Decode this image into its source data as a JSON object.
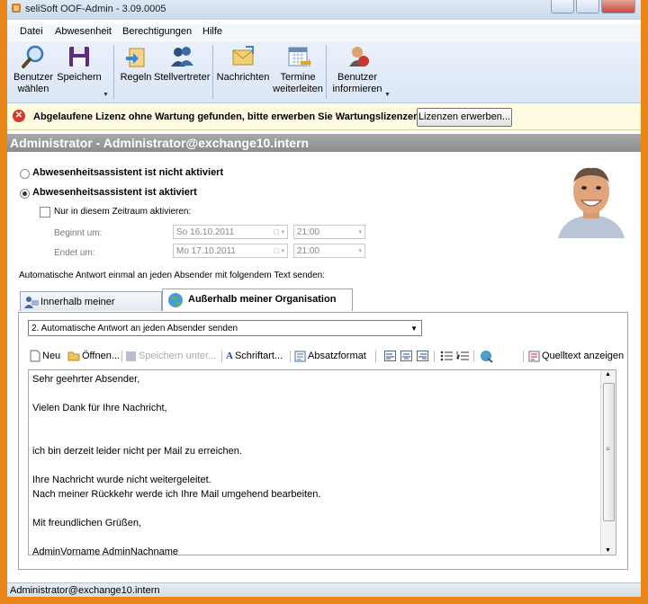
{
  "window": {
    "title": "seliSoft OOF-Admin - 3.09.0005"
  },
  "menu": [
    "Datei",
    "Abwesenheit",
    "Berechtigungen",
    "Hilfe"
  ],
  "toolbar": {
    "user_select": "Benutzer wählen",
    "user_select_l1": "Benutzer",
    "user_select_l2": "wählen",
    "save": "Speichern",
    "rules": "Regeln",
    "deputy": "Stellvertreter",
    "messages": "Nachrichten",
    "forward_l1": "Termine",
    "forward_l2": "weiterleiten",
    "inform_l1": "Benutzer",
    "inform_l2": "informieren"
  },
  "license": {
    "message": "Abgelaufene Lizenz ohne Wartung gefunden, bitte erwerben Sie Wartungslizenzen.",
    "button": "Lizenzen erwerben..."
  },
  "admin_header": "Administrator - Administrator@exchange10.intern",
  "assistant": {
    "option_inactive": "Abwesenheitsassistent ist nicht aktiviert",
    "option_active": "Abwesenheitsassistent ist aktiviert",
    "selected": "active",
    "period_checkbox": "Nur in diesem Zeitraum aktivieren:",
    "period_checked": false,
    "begin_label": "Beginnt um:",
    "end_label": "Endet um:",
    "begin_date": "So 16.10.2011",
    "begin_time": "21:00",
    "end_date": "Mo 17.10.2011",
    "end_time": "21:00",
    "auto_reply_hint": "Automatische Antwort einmal an jeden Absender mit folgendem Text senden:"
  },
  "tabs": {
    "internal": "Innerhalb meiner Organisation",
    "external": "Außerhalb meiner Organisation (An)"
  },
  "reply_mode": "2. Automatische Antwort an jeden Absender senden",
  "editor_toolbar": {
    "new": "Neu",
    "open": "Öffnen...",
    "save_as": "Speichern unter...",
    "font": "Schriftart...",
    "paragraph": "Absatzformat",
    "source": "Quelltext anzeigen"
  },
  "editor_text": "Sehr geehrter Absender,\n\nVielen Dank für Ihre Nachricht,\n\n\nich bin derzeit leider nicht per Mail zu erreichen.\n\nIhre Nachricht wurde nicht weitergeleitet.\nNach meiner Rückkehr werde ich Ihre Mail umgehend bearbeiten.\n\nMit freundlichen Grüßen,\n\nAdminVorname AdminNachname\nTel: AdminBusiness",
  "status": "Administrator@exchange10.intern",
  "colors": {
    "frame": "#e8861a",
    "toolbar_bg": "#dbe6f5",
    "license_bg": "#fffbe0",
    "admin_bar": "#999999"
  }
}
